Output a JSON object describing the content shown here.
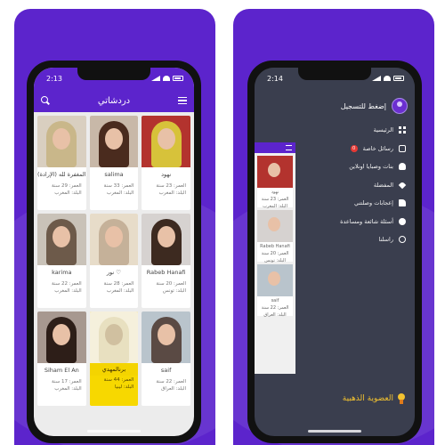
{
  "left": {
    "status_time": "2:13",
    "app_title": "دردشاتي",
    "cards": [
      {
        "name": "المغفرة لله (الإرادة)",
        "age": "العمر: 29 سنة",
        "country": "البلد: المغرب",
        "hair": "#c9b78a"
      },
      {
        "name": "salima",
        "age": "العمر: 33 سنة",
        "country": "البلد: المغرب",
        "hair": "#4a2b1e"
      },
      {
        "name": "نهود",
        "age": "العمر: 23 سنة",
        "country": "البلد: المغرب",
        "hair": "#d7c23a"
      },
      {
        "name": "karima",
        "age": "العمر: 22 سنة",
        "country": "البلد: المغرب",
        "hair": "#6d5a4a"
      },
      {
        "name": "نور ♡",
        "age": "العمر: 28 سنة",
        "country": "البلد: المغرب",
        "hair": "#c5b199"
      },
      {
        "name": "Rabeb Hanafi",
        "age": "العمر: 20 سنة",
        "country": "البلد: تونس",
        "hair": "#3d2a20"
      },
      {
        "name": "Siham El An",
        "age": "العمر: 17 سنة",
        "country": "البلد: المغرب",
        "hair": "#2d1e18"
      },
      {
        "name": "برنالمهدي",
        "age": "العمر: 44 سنة",
        "country": "البلد: ليبيا",
        "hair": "#e8e0c0",
        "gold": true
      },
      {
        "name": "saif",
        "age": "العمر: 22 سنة",
        "country": "البلد: العراق",
        "hair": "#5a4a44"
      }
    ]
  },
  "right": {
    "status_time": "2:14",
    "login_prompt": "إضغط للتسجيل",
    "menu": [
      {
        "label": "الرئيسية",
        "icon": "home-icon"
      },
      {
        "label": "رسائل خاصة",
        "icon": "chat-icon",
        "badge": "0"
      },
      {
        "label": "بنات وصبايا اونلاين",
        "icon": "users-icon"
      },
      {
        "label": "المفضلة",
        "icon": "heart-icon"
      },
      {
        "label": "إعجابات وصلتني",
        "icon": "like-icon"
      },
      {
        "label": "أسئلة شائعة ومساعدة",
        "icon": "help-icon"
      },
      {
        "label": "راسلنا",
        "icon": "contact-icon"
      }
    ],
    "gold_membership": "العضوية الذهبية",
    "peek_cards": [
      {
        "name": "نهود",
        "age": "العمر: 23 سنة",
        "country": "البلد: المغرب"
      },
      {
        "name": "Rabeb Hanafi",
        "age": "العمر: 20 سنة",
        "country": "البلد: تونس"
      },
      {
        "name": "saif",
        "age": "العمر: 22 سنة",
        "country": "البلد: العراق"
      }
    ]
  },
  "colors": {
    "brand": "#5c24cc",
    "drawer": "#3a3e4e",
    "gold": "#f2c230"
  }
}
